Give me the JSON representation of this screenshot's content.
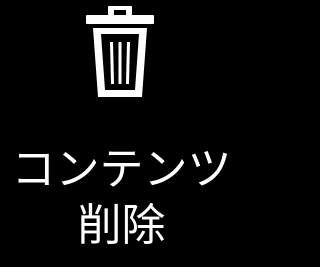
{
  "action": {
    "icon": "trash-icon",
    "label": "コンテンツ削除"
  },
  "colors": {
    "background": "#000000",
    "foreground": "#ffffff"
  }
}
